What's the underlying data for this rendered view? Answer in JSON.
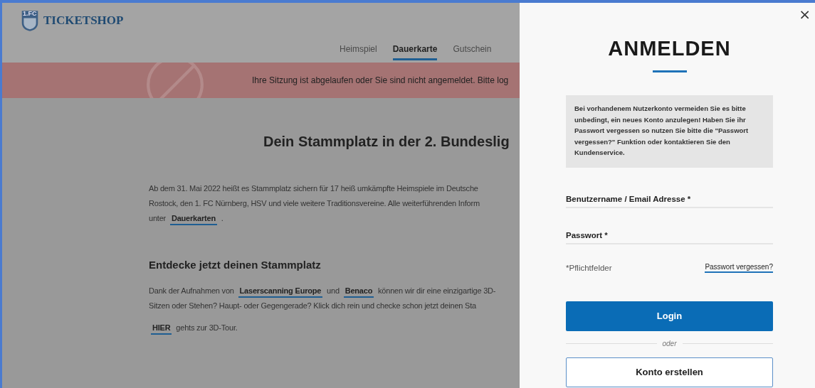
{
  "header": {
    "logo_badge": "1.FC",
    "logo_text": "TICKETSHOP"
  },
  "nav": [
    {
      "label": "Heimspiel",
      "selected": false
    },
    {
      "label": "Dauerkarte",
      "selected": true
    },
    {
      "label": "Gutschein",
      "selected": false
    }
  ],
  "alert": {
    "text": "Ihre Sitzung ist abgelaufen oder Sie sind nicht angemeldet. Bitte log"
  },
  "heading": "Dein Stammplatz in der 2. Bundeslig",
  "intro": [
    [
      {
        "text": "Ab dem 31. Mai 2022 heißt es Stammplatz sichern für 17 heiß umkämpfte Heimspiele im Deutsche",
        "kind": "text"
      }
    ],
    [
      {
        "text": "Rostock, den 1. FC Nürnberg, HSV und viele weitere Traditionsvereine. Alle weiterführenden Inform",
        "kind": "text"
      }
    ],
    [
      {
        "text": "unter ",
        "kind": "text"
      },
      {
        "text": "Dauerkarten",
        "kind": "link"
      },
      {
        "text": " .",
        "kind": "text"
      }
    ]
  ],
  "subheading": "Entdecke jetzt deinen Stammplatz",
  "tour": [
    [
      {
        "text": "Dank der Aufnahmen von ",
        "kind": "text"
      },
      {
        "text": "Laserscanning Europe",
        "kind": "link"
      },
      {
        "text": " und ",
        "kind": "text"
      },
      {
        "text": "Benaco",
        "kind": "link"
      },
      {
        "text": " können wir dir eine einzigartige 3D-",
        "kind": "text"
      }
    ],
    [
      {
        "text": "Sitzen oder Stehen? Haupt- oder Gegengerade? Klick dich rein und checke schon jetzt deinen Sta",
        "kind": "text"
      }
    ]
  ],
  "tour_link": [
    [
      {
        "text": "HIER",
        "kind": "link"
      },
      {
        "text": " gehts zur 3D-Tour.",
        "kind": "text"
      }
    ]
  ],
  "drawer": {
    "close": "×",
    "title": "ANMELDEN",
    "notice": "Bei vorhandenem Nutzerkonto vermeiden Sie es bitte unbedingt, ein neues Konto anzulegen! Haben Sie ihr Passwort vergessen so nutzen Sie bitte die \"Passwort vergessen?\" Funktion oder kontaktieren Sie den Kundenservice.",
    "fields": [
      {
        "label": "Benutzername / Email Adresse *"
      },
      {
        "label": "Passwort *"
      }
    ],
    "required_note": "*Pflichtfelder",
    "forgot": "Passwort vergessen?",
    "login": "Login",
    "separator": "oder",
    "register": "Konto erstellen"
  }
}
